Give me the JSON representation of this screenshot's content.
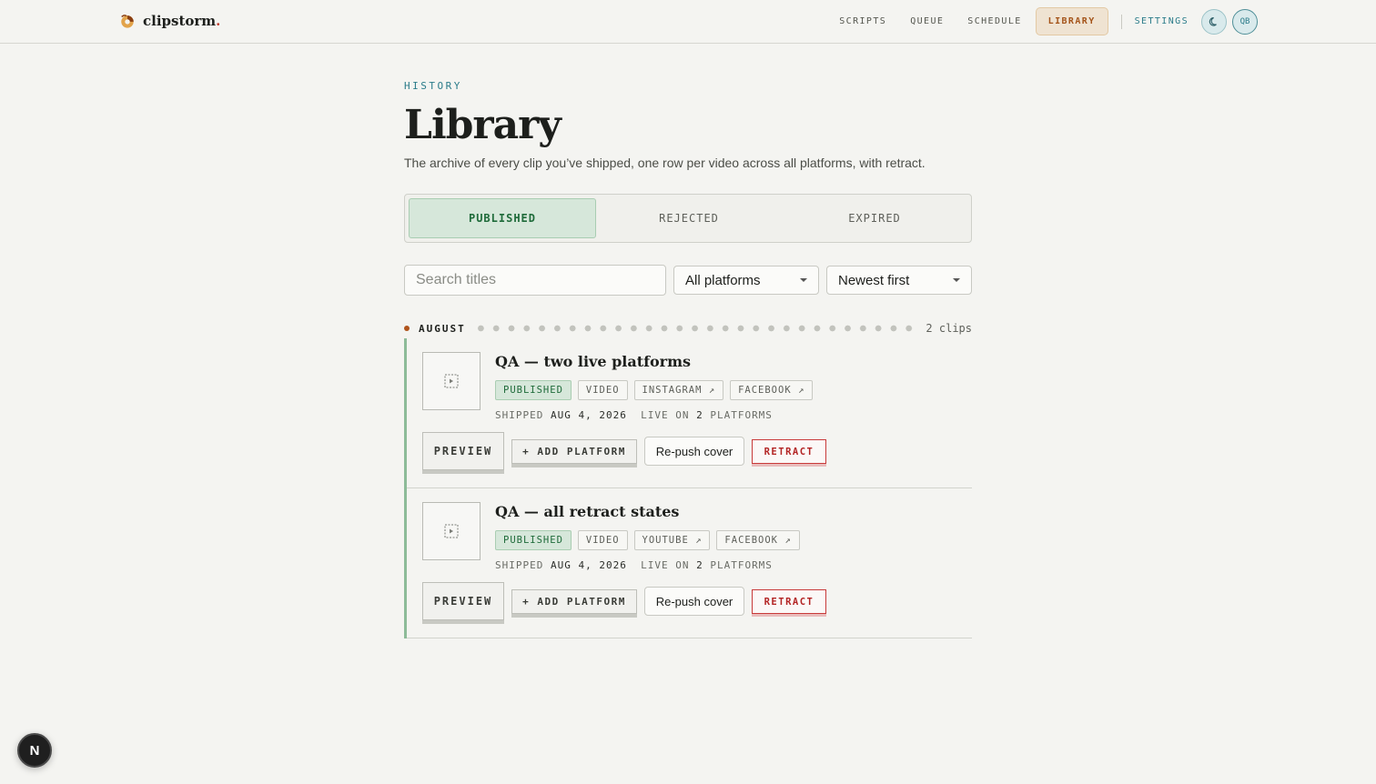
{
  "app": {
    "name": "clipstorm",
    "name_dot": "."
  },
  "nav": {
    "items": [
      {
        "label": "SCRIPTS"
      },
      {
        "label": "QUEUE"
      },
      {
        "label": "SCHEDULE"
      },
      {
        "label": "LIBRARY",
        "active": true
      }
    ],
    "settings_label": "SETTINGS",
    "theme_icon": "moon-icon",
    "avatar_initials": "QB"
  },
  "page": {
    "eyebrow": "HISTORY",
    "title": "Library",
    "subtitle": "The archive of every clip you’ve shipped, one row per video across all platforms, with retract."
  },
  "tabs": [
    {
      "label": "PUBLISHED",
      "active": true
    },
    {
      "label": "REJECTED"
    },
    {
      "label": "EXPIRED"
    }
  ],
  "filters": {
    "search_placeholder": "Search titles",
    "search_value": "",
    "platform_select": "All platforms",
    "sort_select": "Newest first"
  },
  "group": {
    "month": "AUGUST",
    "count": "2 clips"
  },
  "clips": [
    {
      "title": "QA — two live platforms",
      "status": "PUBLISHED",
      "type": "VIDEO",
      "platforms": [
        "INSTAGRAM ↗",
        "FACEBOOK ↗"
      ],
      "shipped_label": "SHIPPED",
      "shipped_date": "AUG 4, 2026",
      "live_prefix": "LIVE ON",
      "live_count": "2",
      "live_suffix": "PLATFORMS",
      "actions": {
        "preview": "PREVIEW",
        "add_platform": "+ ADD PLATFORM",
        "repush": "Re-push cover",
        "retract": "RETRACT"
      }
    },
    {
      "title": "QA — all retract states",
      "status": "PUBLISHED",
      "type": "VIDEO",
      "platforms": [
        "YOUTUBE ↗",
        "FACEBOOK ↗"
      ],
      "shipped_label": "SHIPPED",
      "shipped_date": "AUG 4, 2026",
      "live_prefix": "LIVE ON",
      "live_count": "2",
      "live_suffix": "PLATFORMS",
      "actions": {
        "preview": "PREVIEW",
        "add_platform": "+ ADD PLATFORM",
        "repush": "Re-push cover",
        "retract": "RETRACT"
      }
    }
  ],
  "dev_badge": {
    "label": "N"
  },
  "colors": {
    "accent_teal": "#2b7c8a",
    "accent_orange": "#a4541a",
    "published_green": "#1f6b3a",
    "retract_red": "#b32424"
  }
}
